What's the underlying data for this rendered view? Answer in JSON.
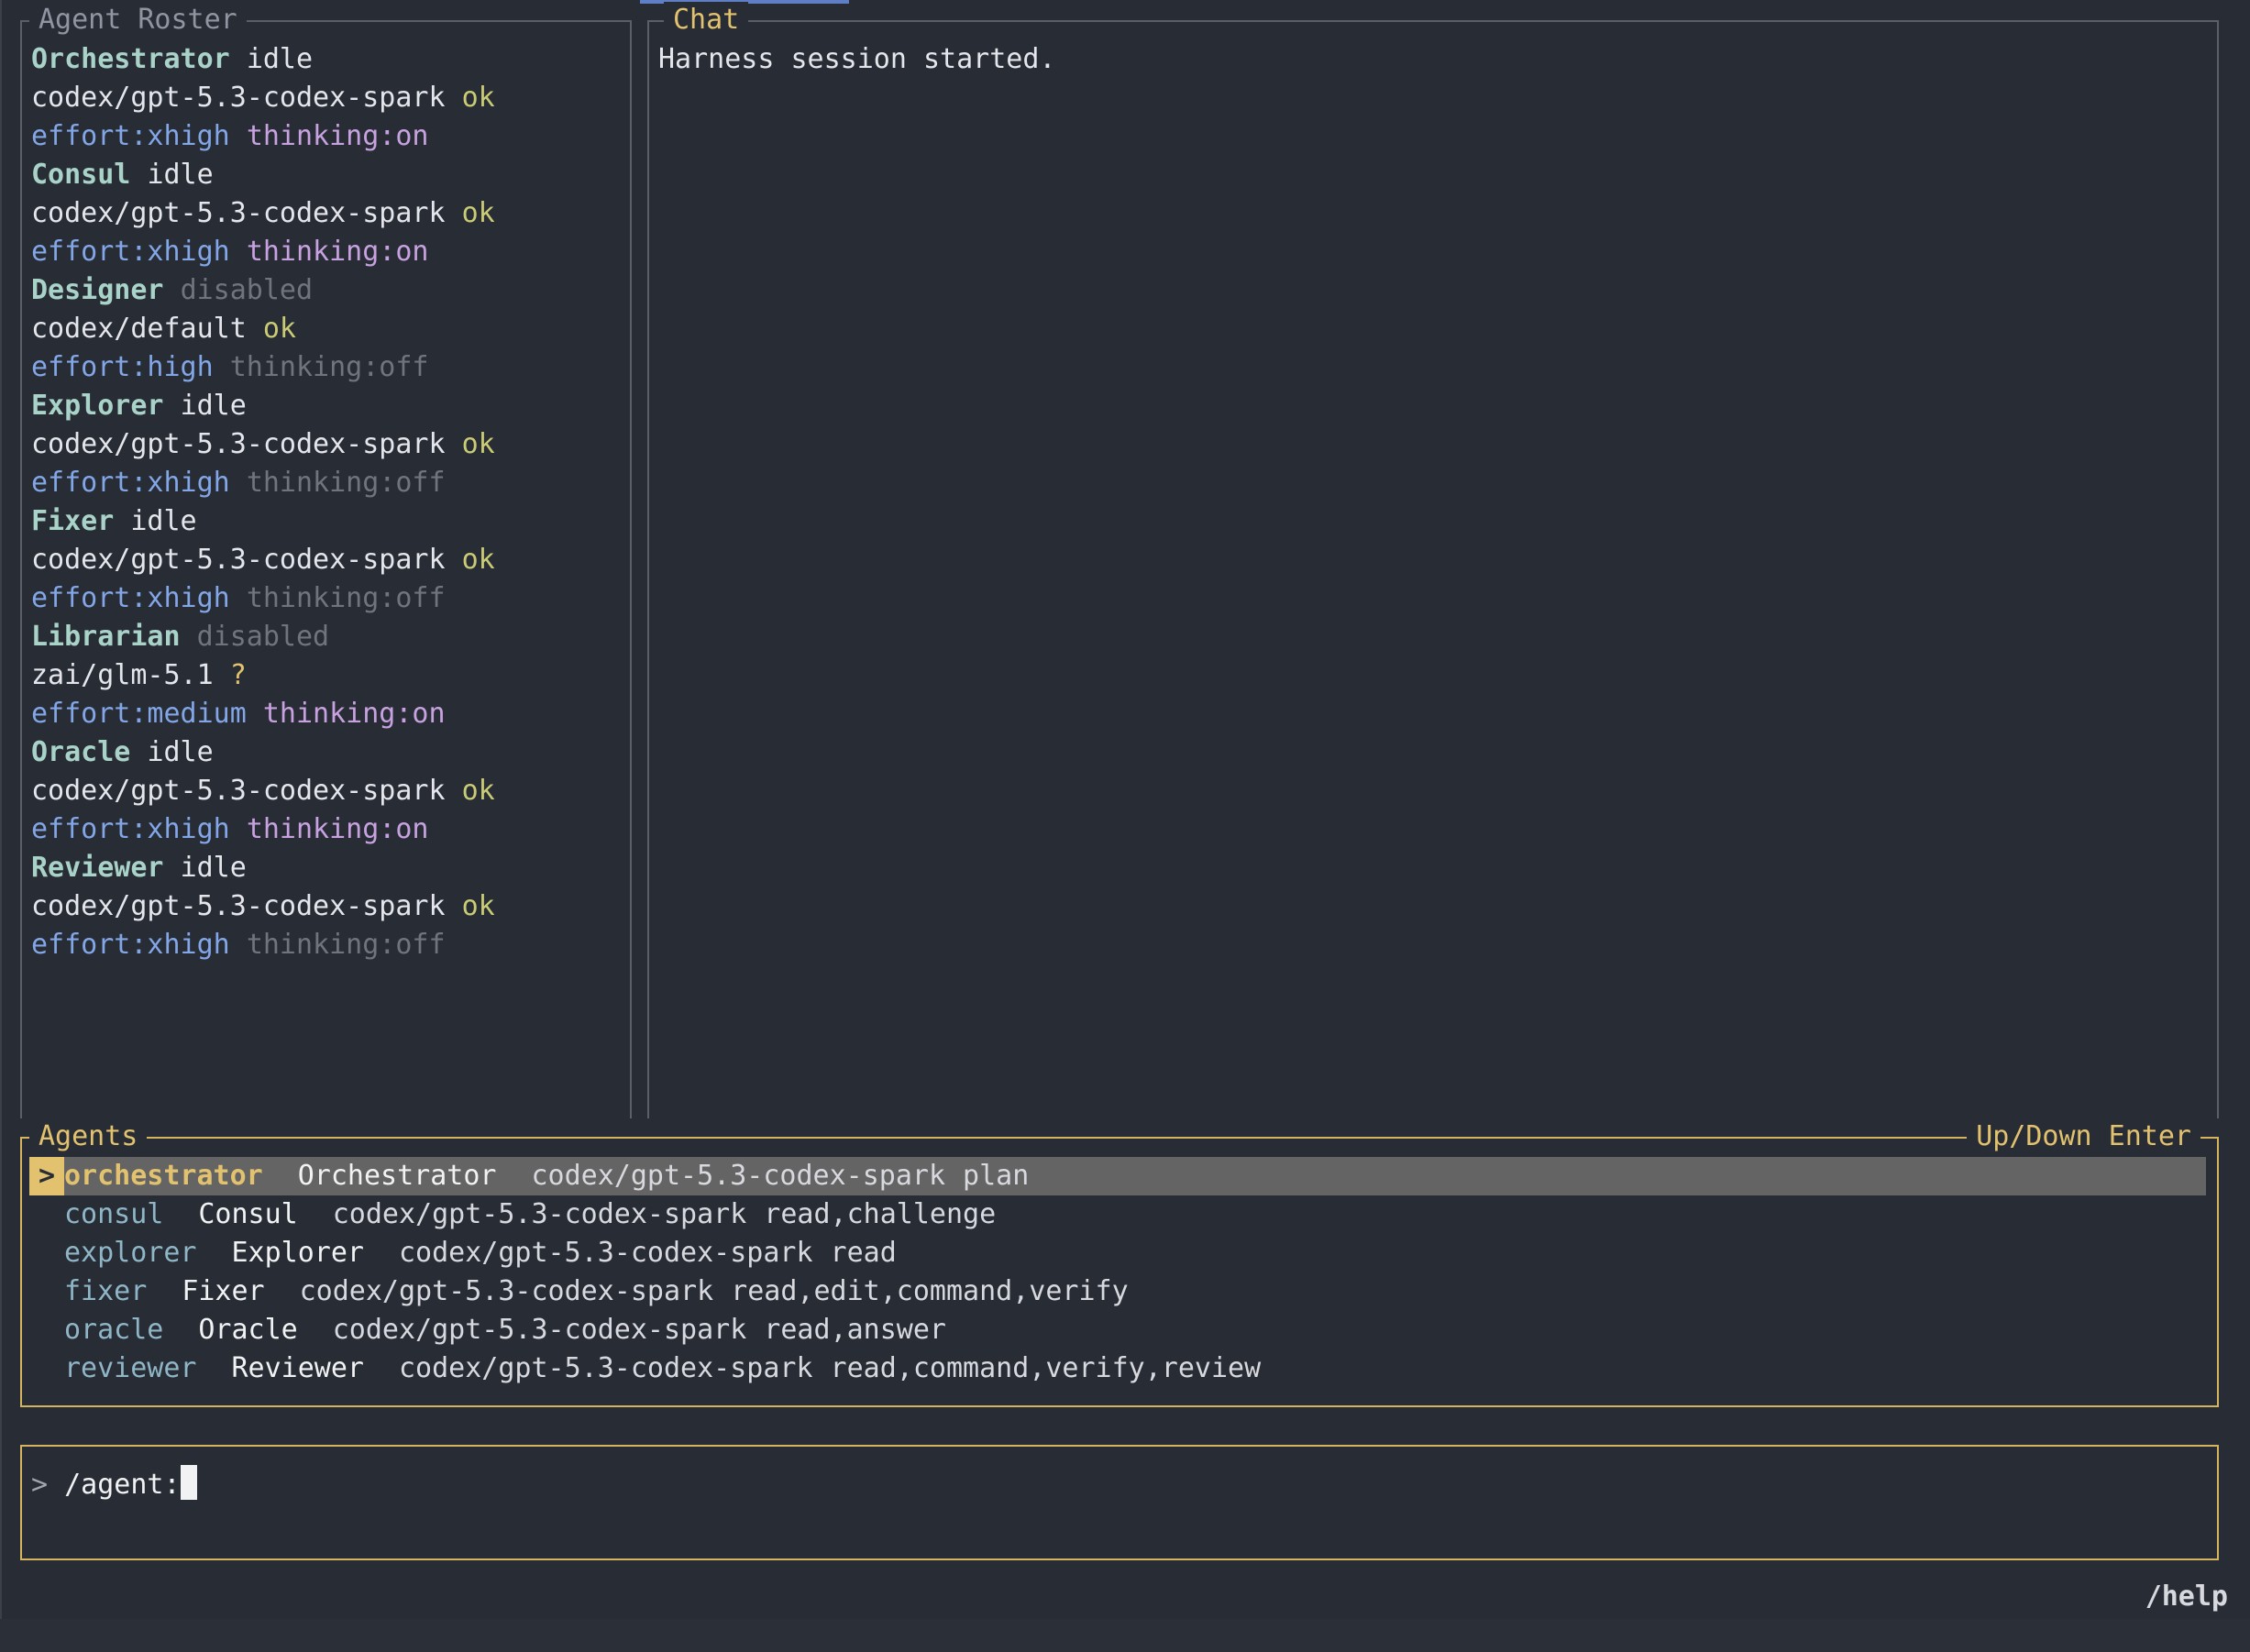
{
  "roster": {
    "title": "Agent Roster",
    "agents": [
      {
        "name": "Orchestrator",
        "status": "idle",
        "status_kind": "idle",
        "model": "codex/gpt-5.3-codex-spark",
        "health": "ok",
        "effort": "effort:xhigh",
        "thinking": "thinking:on",
        "thinking_on": true
      },
      {
        "name": "Consul",
        "status": "idle",
        "status_kind": "idle",
        "model": "codex/gpt-5.3-codex-spark",
        "health": "ok",
        "effort": "effort:xhigh",
        "thinking": "thinking:on",
        "thinking_on": true
      },
      {
        "name": "Designer",
        "status": "disabled",
        "status_kind": "disabled",
        "model": "codex/default",
        "health": "ok",
        "effort": "effort:high",
        "thinking": "thinking:off",
        "thinking_on": false
      },
      {
        "name": "Explorer",
        "status": "idle",
        "status_kind": "idle",
        "model": "codex/gpt-5.3-codex-spark",
        "health": "ok",
        "effort": "effort:xhigh",
        "thinking": "thinking:off",
        "thinking_on": false
      },
      {
        "name": "Fixer",
        "status": "idle",
        "status_kind": "idle",
        "model": "codex/gpt-5.3-codex-spark",
        "health": "ok",
        "effort": "effort:xhigh",
        "thinking": "thinking:off",
        "thinking_on": false
      },
      {
        "name": "Librarian",
        "status": "disabled",
        "status_kind": "disabled",
        "model": "zai/glm-5.1",
        "health": "?",
        "effort": "effort:medium",
        "thinking": "thinking:on",
        "thinking_on": true
      },
      {
        "name": "Oracle",
        "status": "idle",
        "status_kind": "idle",
        "model": "codex/gpt-5.3-codex-spark",
        "health": "ok",
        "effort": "effort:xhigh",
        "thinking": "thinking:on",
        "thinking_on": true
      },
      {
        "name": "Reviewer",
        "status": "idle",
        "status_kind": "idle",
        "model": "codex/gpt-5.3-codex-spark",
        "health": "ok",
        "effort": "effort:xhigh",
        "thinking": "thinking:off",
        "thinking_on": false
      }
    ]
  },
  "chat": {
    "title": "Chat",
    "messages": [
      "Harness session started."
    ]
  },
  "agents_picker": {
    "title": "Agents",
    "hint": "Up/Down Enter",
    "selected_marker": ">",
    "rows": [
      {
        "id": "orchestrator",
        "label": "Orchestrator",
        "model": "codex/gpt-5.3-codex-spark",
        "caps": "plan",
        "selected": true
      },
      {
        "id": "consul",
        "label": "Consul",
        "model": "codex/gpt-5.3-codex-spark",
        "caps": "read,challenge",
        "selected": false
      },
      {
        "id": "explorer",
        "label": "Explorer",
        "model": "codex/gpt-5.3-codex-spark",
        "caps": "read",
        "selected": false
      },
      {
        "id": "fixer",
        "label": "Fixer",
        "model": "codex/gpt-5.3-codex-spark",
        "caps": "read,edit,command,verify",
        "selected": false
      },
      {
        "id": "oracle",
        "label": "Oracle",
        "model": "codex/gpt-5.3-codex-spark",
        "caps": "read,answer",
        "selected": false
      },
      {
        "id": "reviewer",
        "label": "Reviewer",
        "model": "codex/gpt-5.3-codex-spark",
        "caps": "read,command,verify,review",
        "selected": false
      }
    ]
  },
  "input": {
    "prompt_symbol": ">",
    "value": "/agent:"
  },
  "footer": {
    "help": "/help"
  },
  "colors": {
    "background": "#282c35",
    "accent_gold": "#e2c26e",
    "border_gray": "#5a5f69",
    "name_teal": "#a9d3c9",
    "ok_yellow": "#c9cc74",
    "effort_blue": "#82a6e6",
    "thinking_purple": "#c8a2e0",
    "muted": "#6f747d",
    "selection_bg": "#646464"
  }
}
